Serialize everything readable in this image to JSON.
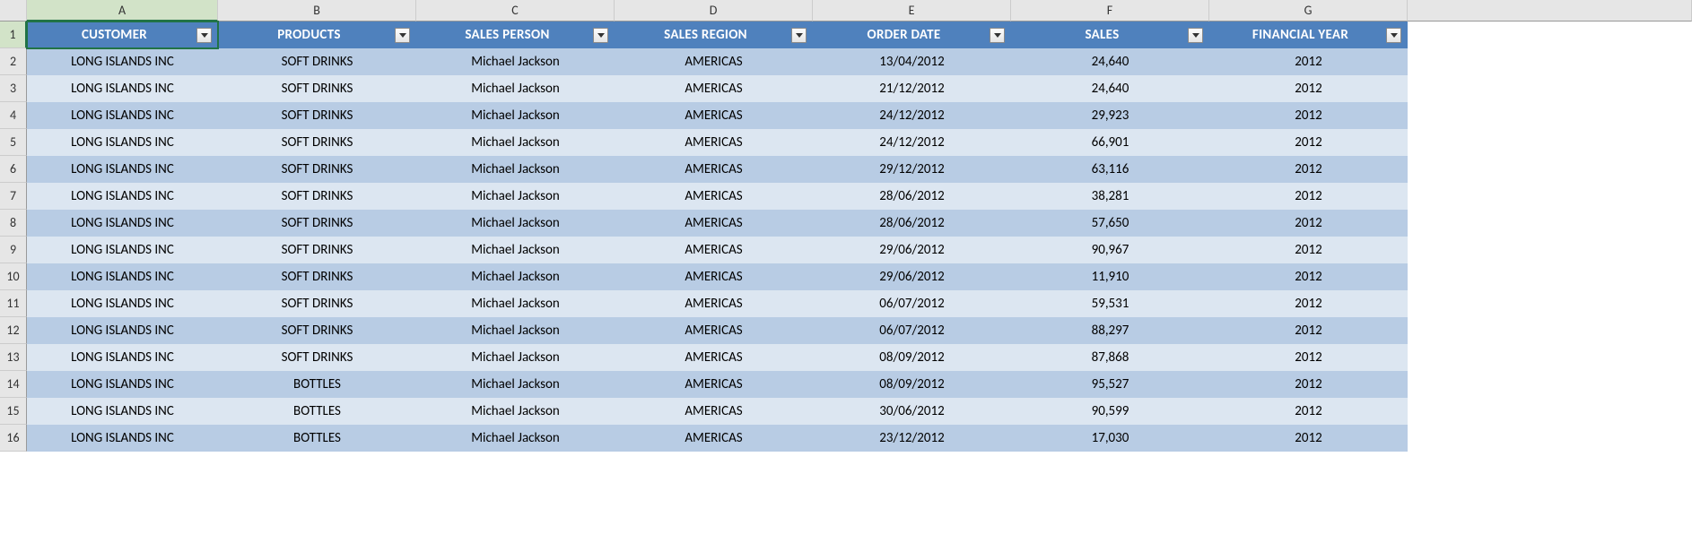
{
  "columns": [
    "A",
    "B",
    "C",
    "D",
    "E",
    "F",
    "G"
  ],
  "headers": {
    "customer": "CUSTOMER",
    "products": "PRODUCTS",
    "sales_person": "SALES PERSON",
    "sales_region": "SALES REGION",
    "order_date": "ORDER DATE",
    "sales": "SALES",
    "financial_year": "FINANCIAL YEAR"
  },
  "rows": [
    {
      "n": "2",
      "customer": "LONG ISLANDS INC",
      "products": "SOFT DRINKS",
      "sales_person": "Michael Jackson",
      "sales_region": "AMERICAS",
      "order_date": "13/04/2012",
      "sales": "24,640",
      "financial_year": "2012"
    },
    {
      "n": "3",
      "customer": "LONG ISLANDS INC",
      "products": "SOFT DRINKS",
      "sales_person": "Michael Jackson",
      "sales_region": "AMERICAS",
      "order_date": "21/12/2012",
      "sales": "24,640",
      "financial_year": "2012"
    },
    {
      "n": "4",
      "customer": "LONG ISLANDS INC",
      "products": "SOFT DRINKS",
      "sales_person": "Michael Jackson",
      "sales_region": "AMERICAS",
      "order_date": "24/12/2012",
      "sales": "29,923",
      "financial_year": "2012"
    },
    {
      "n": "5",
      "customer": "LONG ISLANDS INC",
      "products": "SOFT DRINKS",
      "sales_person": "Michael Jackson",
      "sales_region": "AMERICAS",
      "order_date": "24/12/2012",
      "sales": "66,901",
      "financial_year": "2012"
    },
    {
      "n": "6",
      "customer": "LONG ISLANDS INC",
      "products": "SOFT DRINKS",
      "sales_person": "Michael Jackson",
      "sales_region": "AMERICAS",
      "order_date": "29/12/2012",
      "sales": "63,116",
      "financial_year": "2012"
    },
    {
      "n": "7",
      "customer": "LONG ISLANDS INC",
      "products": "SOFT DRINKS",
      "sales_person": "Michael Jackson",
      "sales_region": "AMERICAS",
      "order_date": "28/06/2012",
      "sales": "38,281",
      "financial_year": "2012"
    },
    {
      "n": "8",
      "customer": "LONG ISLANDS INC",
      "products": "SOFT DRINKS",
      "sales_person": "Michael Jackson",
      "sales_region": "AMERICAS",
      "order_date": "28/06/2012",
      "sales": "57,650",
      "financial_year": "2012"
    },
    {
      "n": "9",
      "customer": "LONG ISLANDS INC",
      "products": "SOFT DRINKS",
      "sales_person": "Michael Jackson",
      "sales_region": "AMERICAS",
      "order_date": "29/06/2012",
      "sales": "90,967",
      "financial_year": "2012"
    },
    {
      "n": "10",
      "customer": "LONG ISLANDS INC",
      "products": "SOFT DRINKS",
      "sales_person": "Michael Jackson",
      "sales_region": "AMERICAS",
      "order_date": "29/06/2012",
      "sales": "11,910",
      "financial_year": "2012"
    },
    {
      "n": "11",
      "customer": "LONG ISLANDS INC",
      "products": "SOFT DRINKS",
      "sales_person": "Michael Jackson",
      "sales_region": "AMERICAS",
      "order_date": "06/07/2012",
      "sales": "59,531",
      "financial_year": "2012"
    },
    {
      "n": "12",
      "customer": "LONG ISLANDS INC",
      "products": "SOFT DRINKS",
      "sales_person": "Michael Jackson",
      "sales_region": "AMERICAS",
      "order_date": "06/07/2012",
      "sales": "88,297",
      "financial_year": "2012"
    },
    {
      "n": "13",
      "customer": "LONG ISLANDS INC",
      "products": "SOFT DRINKS",
      "sales_person": "Michael Jackson",
      "sales_region": "AMERICAS",
      "order_date": "08/09/2012",
      "sales": "87,868",
      "financial_year": "2012"
    },
    {
      "n": "14",
      "customer": "LONG ISLANDS INC",
      "products": "BOTTLES",
      "sales_person": "Michael Jackson",
      "sales_region": "AMERICAS",
      "order_date": "08/09/2012",
      "sales": "95,527",
      "financial_year": "2012"
    },
    {
      "n": "15",
      "customer": "LONG ISLANDS INC",
      "products": "BOTTLES",
      "sales_person": "Michael Jackson",
      "sales_region": "AMERICAS",
      "order_date": "30/06/2012",
      "sales": "90,599",
      "financial_year": "2012"
    },
    {
      "n": "16",
      "customer": "LONG ISLANDS INC",
      "products": "BOTTLES",
      "sales_person": "Michael Jackson",
      "sales_region": "AMERICAS",
      "order_date": "23/12/2012",
      "sales": "17,030",
      "financial_year": "2012"
    }
  ],
  "row1_label": "1",
  "selected_cell": "A1"
}
